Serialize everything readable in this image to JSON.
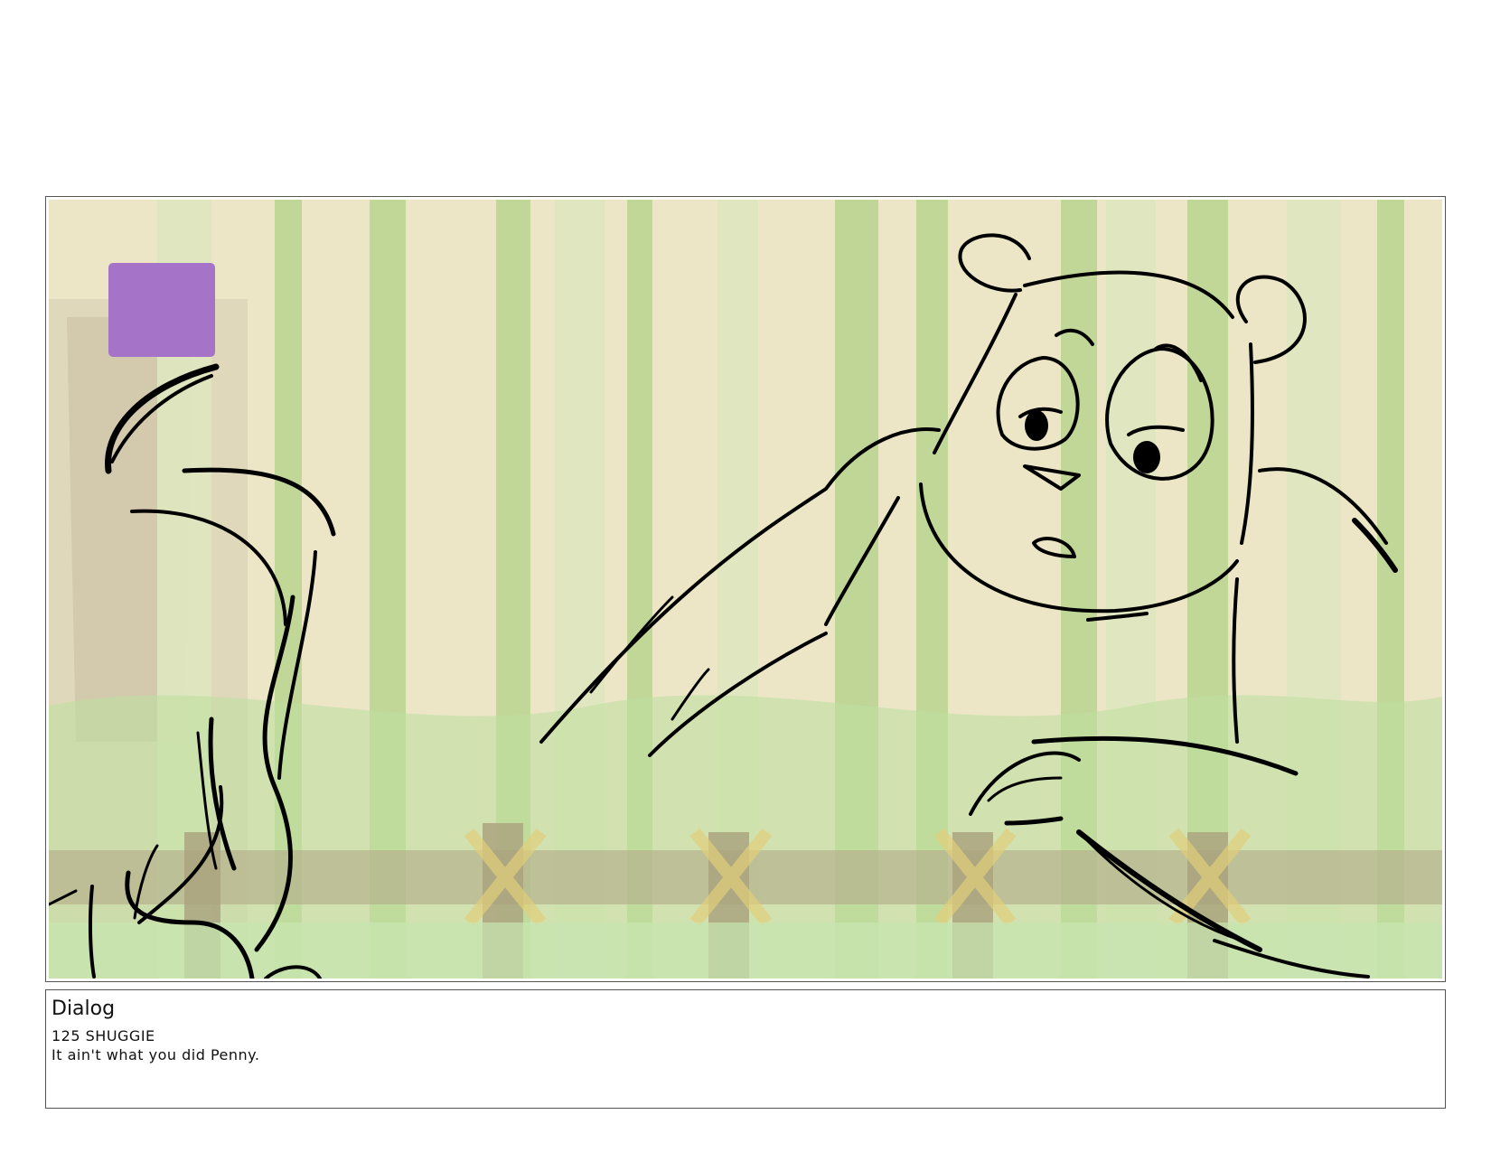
{
  "storyboard": {
    "panel": {
      "marker_color": "#a574c9"
    },
    "dialog": {
      "heading": "Dialog",
      "speaker_line": "125 SHUGGIE",
      "text": "It ain't what you did Penny."
    }
  }
}
